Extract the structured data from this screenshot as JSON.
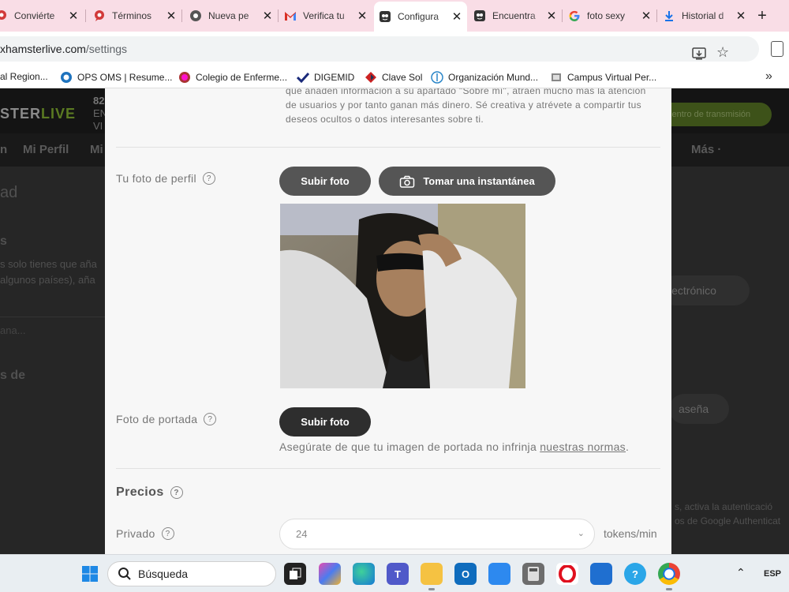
{
  "tabs": [
    {
      "title": "Conviérte",
      "icon": "chat-bubble-icon",
      "active": false
    },
    {
      "title": "Términos",
      "icon": "chat-bubble-icon",
      "active": false
    },
    {
      "title": "Nueva pe",
      "icon": "globe-icon",
      "active": false
    },
    {
      "title": "Verifica tu",
      "icon": "gmail-icon",
      "active": false
    },
    {
      "title": "Configura",
      "icon": "cam-site-icon",
      "active": true
    },
    {
      "title": "Encuentra",
      "icon": "cam-site-icon",
      "active": false
    },
    {
      "title": "foto sexy",
      "icon": "google-icon",
      "active": false
    },
    {
      "title": "Historial d",
      "icon": "download-icon",
      "active": false
    }
  ],
  "address_bar": {
    "url_host": "xhamsterlive.com",
    "url_path": "/settings"
  },
  "bookmarks": [
    {
      "label": "al Region...",
      "icon": ""
    },
    {
      "label": "OPS OMS | Resume...",
      "icon": "ops-icon"
    },
    {
      "label": "Colegio de Enferme...",
      "icon": "seal-icon"
    },
    {
      "label": "DIGEMID",
      "icon": "check-logo-icon"
    },
    {
      "label": "Clave Sol",
      "icon": "sunat-icon"
    },
    {
      "label": "Organización Mund...",
      "icon": "who-icon"
    },
    {
      "label": "Campus Virtual Per...",
      "icon": "campus-icon"
    }
  ],
  "site": {
    "brand_left": "STER",
    "brand_right": "LIVE",
    "header_num": "82",
    "header_en": "EN",
    "header_vi": "VI",
    "broadcast_button": "centro de transmisión",
    "nav": [
      "n",
      "Mi Perfil",
      "Mi",
      "Más ·"
    ],
    "bg_title": "ad",
    "bg_section": "s",
    "bg_line1": "s solo tienes que aña",
    "bg_line2": "algunos países), aña",
    "bg_input": "ana...",
    "bg_section2": "s de",
    "bg_email_pill": "lectrónico",
    "bg_password_pill": "aseña",
    "bg_right1": "s, activa la autenticació",
    "bg_right2": "os de Google Authenticat"
  },
  "modal": {
    "intro_text": "que añaden información a su apartado \"Sobre mí\", atraen mucho más la atención de usuarios y por tanto ganan más dinero. Sé creativa y atrévete a compartir tus deseos ocultos o datos interesantes sobre ti.",
    "profile_photo_label": "Tu foto de perfil",
    "upload_photo_button": "Subir foto",
    "take_snapshot_button": "Tomar una instantánea",
    "cover_photo_label": "Foto de portada",
    "cover_upload_button": "Subir foto",
    "cover_note_prefix": "Asegúrate de que tu imagen de portada no infrinja ",
    "cover_note_link": "nuestras normas",
    "cover_note_suffix": ".",
    "prices_heading": "Precios",
    "private_label": "Privado",
    "private_price_value": "24",
    "price_unit": "tokens/min",
    "help_glyph": "?"
  },
  "taskbar": {
    "search_label": "Búsqueda",
    "language": "ESP"
  },
  "colors": {
    "tab_strip": "#f9dde6",
    "modal_bg": "#f7f7f7",
    "button_gray": "#555555",
    "button_dark": "#2e2e2e",
    "brand_green": "#5b7a22"
  }
}
